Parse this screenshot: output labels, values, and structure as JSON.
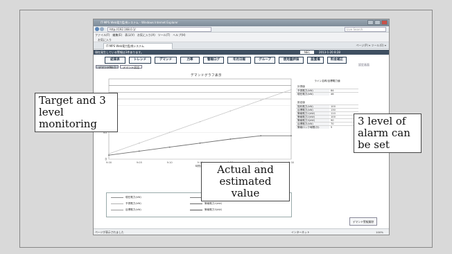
{
  "window": {
    "title": "IT-MPS Web電力監視システム - Windows Internet Explorer",
    "url": "http://192.168.0.1/",
    "search_placeholder": "Live Search",
    "menu": [
      "ファイル(F)",
      "編集(E)",
      "表示(V)",
      "お気に入り(A)",
      "ツール(T)",
      "ヘルプ(H)"
    ],
    "favorites": "お気に入り",
    "tab_label": "IT-MPS Web電力監視システム",
    "tools": "ページ(P) ▾  ツール(O) ▾"
  },
  "app": {
    "status_message": "現在発生している警報は3件あります。",
    "user": "NEC",
    "datetime": "2013-1-20 8:28",
    "setting_label": "設定画面",
    "nav": [
      "結果表",
      "トレンド",
      "デマンド",
      "力率",
      "警報ログ",
      "年月日報",
      "グループ",
      "使用量評価",
      "設置備",
      "料金補正"
    ],
    "subtabs": [
      "デマンドNo.1",
      "デマンド設定"
    ],
    "chart_title": "デマンドグラフ表示",
    "panel": {
      "header": "ライン名称/目標電力値",
      "sec1": "計測値",
      "rows1": [
        {
          "label": "予測電力(kW)",
          "value": "84"
        },
        {
          "label": "現在電力(kW)",
          "value": "46"
        }
      ],
      "sec2": "設定値",
      "rows2": [
        {
          "label": "契約電力(kW)",
          "value": "100"
        },
        {
          "label": "目標電力(kW)",
          "value": "130"
        },
        {
          "label": "警報電力1(kW)",
          "value": "110"
        },
        {
          "label": "警報電力2(kW)",
          "value": "100"
        },
        {
          "label": "警報電力3(kW)",
          "value": "90"
        },
        {
          "label": "目標電力(kW)",
          "value": "70"
        },
        {
          "label": "警報ロック時間(分)",
          "value": "5"
        }
      ]
    },
    "legend": [
      {
        "label": "現在電力(kW)",
        "color": "#8a8a8a"
      },
      {
        "label": "予測電力(kW)",
        "color": "#b0b0b0"
      },
      {
        "label": "目標電力(kW)",
        "color": "#999999"
      },
      {
        "label": "警報電力1(kW)",
        "color": "#777777"
      },
      {
        "label": "警報電力2(kW)",
        "color": "#666666"
      },
      {
        "label": "警報電力3(kW)",
        "color": "#555555"
      }
    ],
    "demand_button": "デマンド警報解除",
    "statusbar_left": "ページが表示されました",
    "statusbar_zone": "インターネット",
    "statusbar_zoom": "100%"
  },
  "callouts": {
    "target": "Target and 3 level monitoring",
    "actual": "Actual and estimated value",
    "alarm": "3 level of alarm can be set"
  },
  "chart_data": {
    "type": "line",
    "x": [
      "9:00",
      "9:05",
      "9:10",
      "9:15",
      "9:20",
      "9:25",
      "9:30"
    ],
    "xlabel": "時間(分)",
    "ylabel": "",
    "ylim": [
      0,
      120
    ],
    "yticks": [
      0,
      40,
      80
    ],
    "series": [
      {
        "name": "予測電力(kW)",
        "values": [
          8,
          24,
          40,
          56,
          72,
          88,
          104
        ]
      },
      {
        "name": "現在電力(kW)",
        "values": [
          6,
          12,
          18,
          24,
          30,
          35,
          35
        ]
      }
    ],
    "hlines": [
      110,
      100,
      90
    ]
  }
}
